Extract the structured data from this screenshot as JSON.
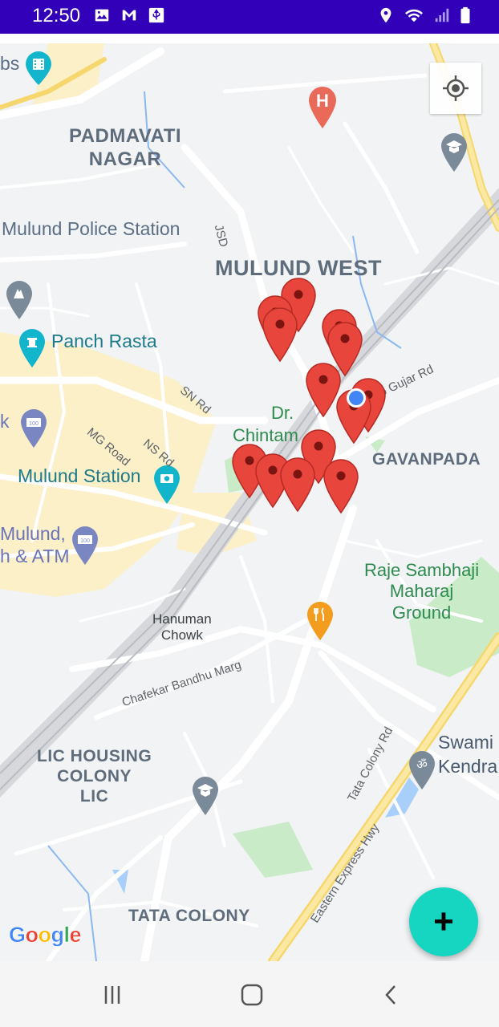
{
  "status_bar": {
    "time": "12:50",
    "left_icons": [
      "image-icon",
      "gmail-icon",
      "usb-icon"
    ],
    "right_icons": [
      "location-icon",
      "wifi-icon",
      "signal-icon",
      "battery-icon"
    ]
  },
  "map": {
    "area_labels": {
      "padmavati": "PADMAVATI\nNAGAR",
      "mulund_west": "MULUND WEST",
      "gavanpada": "GAVANPADA",
      "lic_housing": "LIC HOUSING\nCOLONY\nLIC",
      "tata_colony": "TATA COLONY"
    },
    "poi_labels": {
      "labs": "bs",
      "police": "Mulund Police Station",
      "panch_rasta": "Panch Rasta",
      "bank": "k",
      "mulund_station": "Mulund Station",
      "mulund_atm_1": "Mulund,",
      "mulund_atm_2": "h & ATM",
      "dr_1": "Dr.",
      "dr_2": "Chintam",
      "raje": "Raje Sambhaji\nMaharaj\nGround",
      "hanuman": "Hanuman\nChowk",
      "swami_1": "Swami",
      "swami_2": "Kendra"
    },
    "road_labels": {
      "jsd": "JSD",
      "sn_rd": "SN Rd",
      "ns_rd": "NS Rd",
      "mg_road": "MG Road",
      "gujar_rd": "rao Gujar Rd",
      "chafekar": "Chafekar Bandhu Marg",
      "tata_colony_rd": "Tata Colony Rd",
      "eastern_express": "Eastern Express Hwy"
    },
    "marker_count": 13,
    "marker_color": "#e8453c",
    "accent_blue_dot": "#4285f4"
  },
  "controls": {
    "my_location_icon": "crosshair-icon",
    "fab_label": "+",
    "fab_color": "#16d5c1"
  },
  "google_logo": [
    "G",
    "o",
    "o",
    "g",
    "l",
    "e"
  ],
  "nav_bar": {
    "icons": [
      "recents-icon",
      "home-icon",
      "back-icon"
    ]
  }
}
